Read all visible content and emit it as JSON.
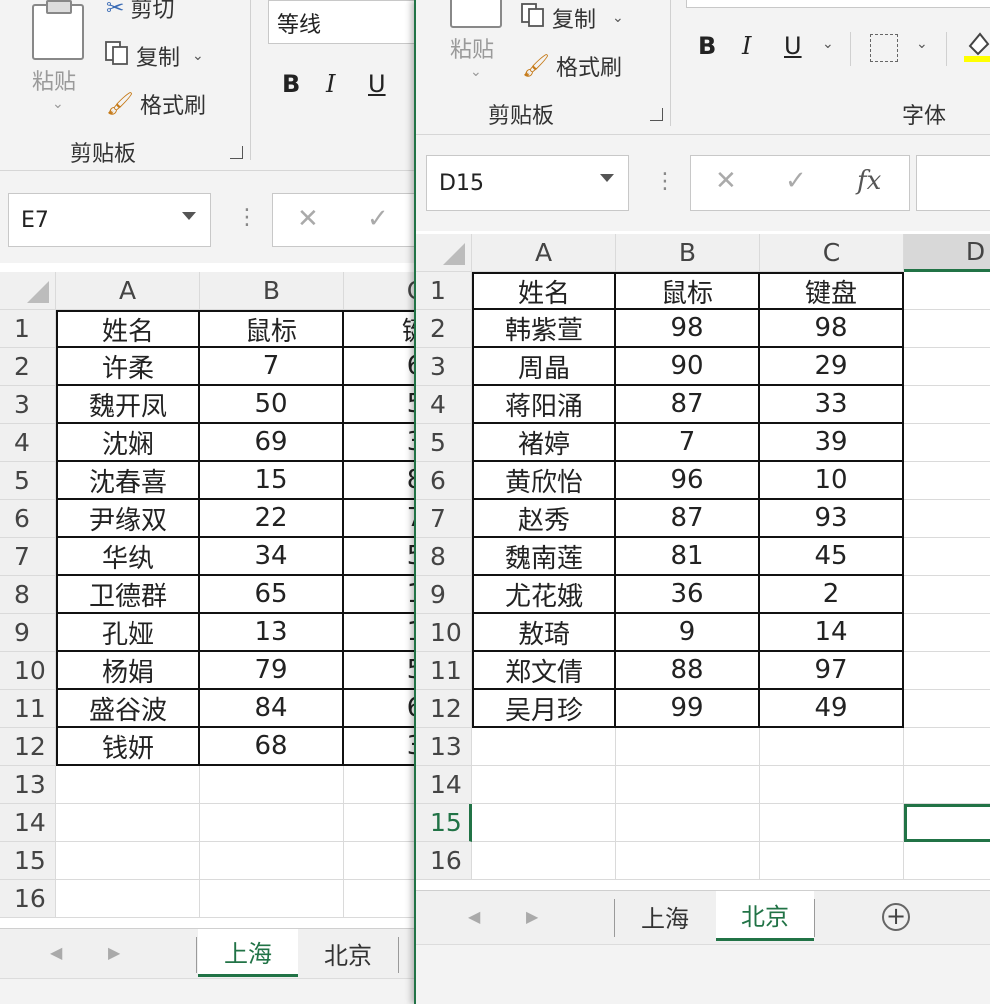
{
  "left": {
    "ribbon": {
      "paste_label": "粘贴",
      "cut_label": "剪切",
      "copy_label": "复制",
      "format_painter_label": "格式刷",
      "clipboard_group_label": "剪贴板",
      "font_name": "等线",
      "bold": "B",
      "italic": "I",
      "underline": "U"
    },
    "name_box": "E7",
    "columns": [
      "A",
      "B",
      "C"
    ],
    "rows": [
      {
        "n": "1",
        "a": "姓名",
        "b": "鼠标",
        "c": "键"
      },
      {
        "n": "2",
        "a": "许柔",
        "b": "7",
        "c": "6"
      },
      {
        "n": "3",
        "a": "魏开凤",
        "b": "50",
        "c": "5"
      },
      {
        "n": "4",
        "a": "沈娴",
        "b": "69",
        "c": "3"
      },
      {
        "n": "5",
        "a": "沈春喜",
        "b": "15",
        "c": "8"
      },
      {
        "n": "6",
        "a": "尹缘双",
        "b": "22",
        "c": "7"
      },
      {
        "n": "7",
        "a": "华纨",
        "b": "34",
        "c": "5"
      },
      {
        "n": "8",
        "a": "卫德群",
        "b": "65",
        "c": "1"
      },
      {
        "n": "9",
        "a": "孔娅",
        "b": "13",
        "c": "1"
      },
      {
        "n": "10",
        "a": "杨娟",
        "b": "79",
        "c": "5"
      },
      {
        "n": "11",
        "a": "盛谷波",
        "b": "84",
        "c": "6"
      },
      {
        "n": "12",
        "a": "钱妍",
        "b": "68",
        "c": "3"
      },
      {
        "n": "13",
        "a": "",
        "b": "",
        "c": ""
      },
      {
        "n": "14",
        "a": "",
        "b": "",
        "c": ""
      },
      {
        "n": "15",
        "a": "",
        "b": "",
        "c": ""
      },
      {
        "n": "16",
        "a": "",
        "b": "",
        "c": ""
      }
    ],
    "tabs": [
      "上海",
      "北京"
    ],
    "active_tab": "上海"
  },
  "right": {
    "ribbon": {
      "paste_label": "粘贴",
      "copy_label": "复制",
      "format_painter_label": "格式刷",
      "clipboard_group_label": "剪贴板",
      "font_group_label": "字体",
      "bold": "B",
      "italic": "I",
      "underline": "U"
    },
    "name_box": "D15",
    "fx_label": "fx",
    "columns": [
      "A",
      "B",
      "C",
      "D"
    ],
    "rows": [
      {
        "n": "1",
        "a": "姓名",
        "b": "鼠标",
        "c": "键盘"
      },
      {
        "n": "2",
        "a": "韩紫萱",
        "b": "98",
        "c": "98"
      },
      {
        "n": "3",
        "a": "周晶",
        "b": "90",
        "c": "29"
      },
      {
        "n": "4",
        "a": "蒋阳涌",
        "b": "87",
        "c": "33"
      },
      {
        "n": "5",
        "a": "褚婷",
        "b": "7",
        "c": "39"
      },
      {
        "n": "6",
        "a": "黄欣怡",
        "b": "96",
        "c": "10"
      },
      {
        "n": "7",
        "a": "赵秀",
        "b": "87",
        "c": "93"
      },
      {
        "n": "8",
        "a": "魏南莲",
        "b": "81",
        "c": "45"
      },
      {
        "n": "9",
        "a": "尤花娥",
        "b": "36",
        "c": "2"
      },
      {
        "n": "10",
        "a": "敖琦",
        "b": "9",
        "c": "14"
      },
      {
        "n": "11",
        "a": "郑文倩",
        "b": "88",
        "c": "97"
      },
      {
        "n": "12",
        "a": "吴月珍",
        "b": "99",
        "c": "49"
      },
      {
        "n": "13",
        "a": "",
        "b": "",
        "c": ""
      },
      {
        "n": "14",
        "a": "",
        "b": "",
        "c": ""
      },
      {
        "n": "15",
        "a": "",
        "b": "",
        "c": ""
      },
      {
        "n": "16",
        "a": "",
        "b": "",
        "c": ""
      }
    ],
    "tabs": [
      "上海",
      "北京"
    ],
    "active_tab": "北京",
    "accent": "#217346"
  }
}
